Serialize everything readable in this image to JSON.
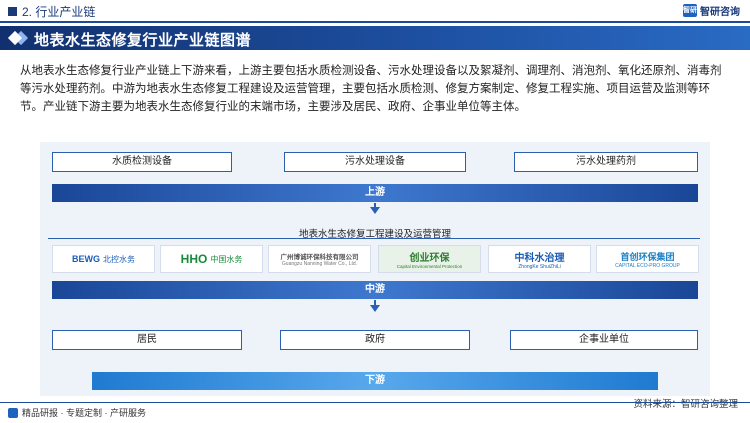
{
  "header": {
    "section_title": "2. 行业产业链",
    "brand_logo_text": "智研",
    "brand_name": "智研咨询"
  },
  "banner_title": "地表水生态修复行业产业链图谱",
  "intro_text": "从地表水生态修复行业产业链上下游来看，上游主要包括水质检测设备、污水处理设备以及絮凝剂、调理剂、消泡剂、氧化还原剂、消毒剂等污水处理药剂。中游为地表水生态修复工程建设及运营管理，主要包括水质检测、修复方案制定、修复工程实施、项目运营及监测等环节。产业链下游主要为地表水生态修复行业的末端市场，主要涉及居民、政府、企事业单位等主体。",
  "upstream": {
    "items": [
      "水质检测设备",
      "污水处理设备",
      "污水处理药剂"
    ],
    "label": "上游"
  },
  "midstream": {
    "title": "地表水生态修复工程建设及运营管理",
    "companies": [
      {
        "mark": "BEWG",
        "text": "北控水务",
        "color": "#1b5db5"
      },
      {
        "mark": "HHO",
        "text": "中国水务",
        "color": "#1a8a3a"
      },
      {
        "mark": "广州博诚环保科技有限公司",
        "text": "Guangzu Nanning Water Co., Ltd.",
        "color": "#555555"
      },
      {
        "mark": "创业环保",
        "text": "Capital Environmental Protection",
        "color": "#2e7d32"
      },
      {
        "mark": "中科水治理",
        "text": "ZhongKe ShuiZhiLi",
        "color": "#1b5db5"
      },
      {
        "mark": "首创环保集团",
        "text": "CAPITAL ECO-PRO GROUP",
        "color": "#1a7fc4"
      }
    ],
    "label": "中游"
  },
  "downstream": {
    "items": [
      "居民",
      "政府",
      "企事业单位"
    ],
    "label": "下游"
  },
  "footer": {
    "left_text": "精品研报 · 专题定制 · 产研服务",
    "source": "资料来源：智研咨询整理"
  },
  "colors": {
    "primary": "#1a3a7a",
    "accent": "#2d5fb0",
    "panel_bg": "#eef3fa"
  }
}
